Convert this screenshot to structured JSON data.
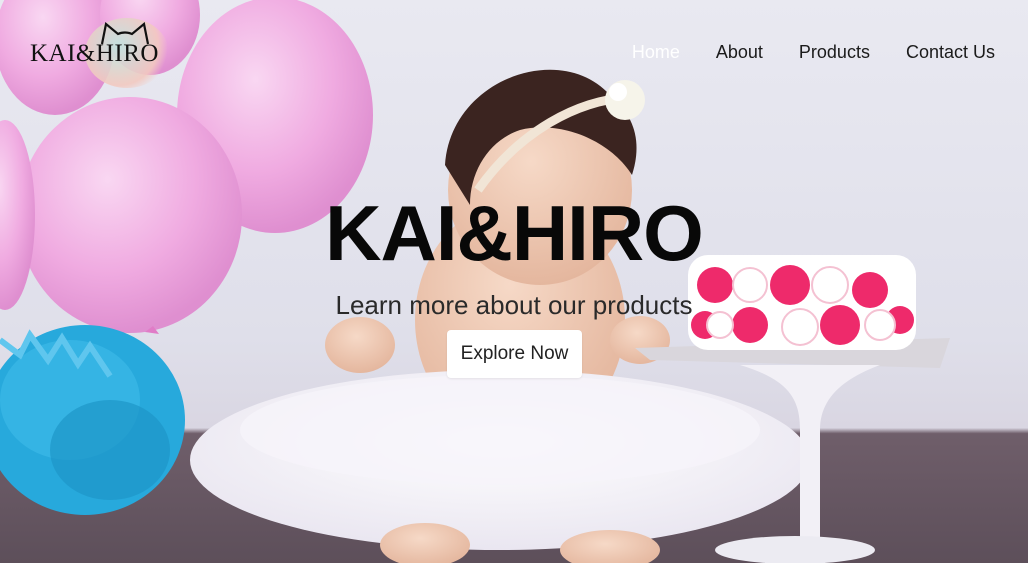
{
  "brand": {
    "logo_text": "KAI&HIRO"
  },
  "nav": {
    "items": [
      {
        "label": "Home",
        "active": true
      },
      {
        "label": "About",
        "active": false
      },
      {
        "label": "Products",
        "active": false
      },
      {
        "label": "Contact Us",
        "active": false
      }
    ]
  },
  "hero": {
    "title": "KAI&HIRO",
    "subtitle": "Learn more about our products",
    "cta_label": "Explore Now",
    "image_description_icon": "baby-photo"
  },
  "colors": {
    "nav_active": "#ffffff",
    "nav_text": "#1b1b1b",
    "balloon": "#f4b4e6",
    "pompom": "#27a9dc",
    "cake_pink": "#ee2a6b"
  }
}
